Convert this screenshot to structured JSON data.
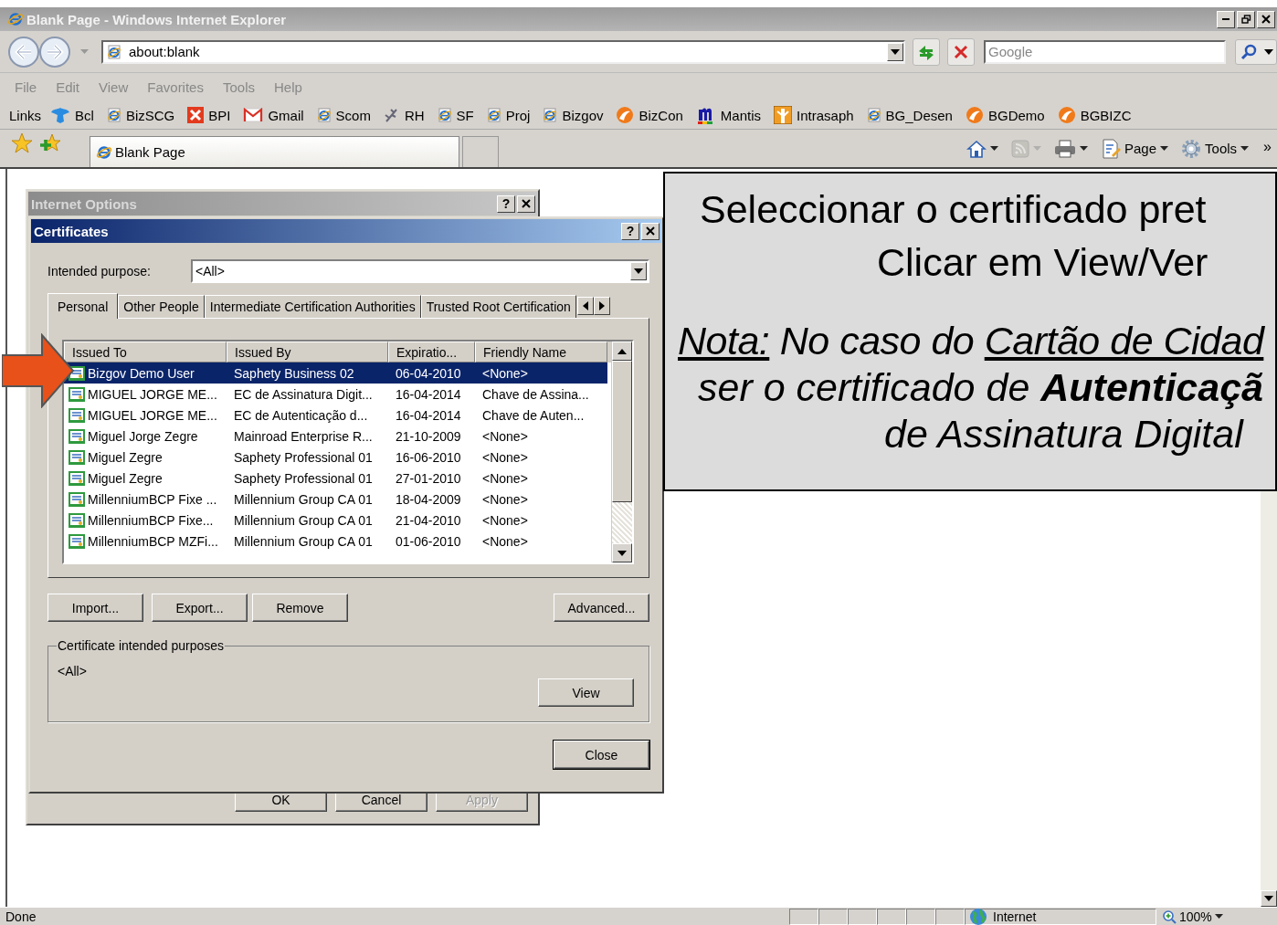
{
  "window": {
    "title": "Blank Page - Windows Internet Explorer"
  },
  "address_bar": {
    "value": "about:blank"
  },
  "search": {
    "placeholder": "Google"
  },
  "menu": [
    "File",
    "Edit",
    "View",
    "Favorites",
    "Tools",
    "Help"
  ],
  "links": {
    "label": "Links",
    "items": [
      {
        "label": "Bcl",
        "kind": "bird"
      },
      {
        "label": "BizSCG",
        "kind": "ie"
      },
      {
        "label": "BPI",
        "kind": "tile"
      },
      {
        "label": "Gmail",
        "kind": "mail"
      },
      {
        "label": "Scom",
        "kind": "ie"
      },
      {
        "label": "RH",
        "kind": "sprig"
      },
      {
        "label": "SF",
        "kind": "ie"
      },
      {
        "label": "Proj",
        "kind": "ie"
      },
      {
        "label": "Bizgov",
        "kind": "ie"
      },
      {
        "label": "BizCon",
        "kind": "orb"
      },
      {
        "label": "Mantis",
        "kind": "arch"
      },
      {
        "label": "Intrasaph",
        "kind": "tree"
      },
      {
        "label": "BG_Desen",
        "kind": "ie"
      },
      {
        "label": "BGDemo",
        "kind": "orb"
      },
      {
        "label": "BGBIZC",
        "kind": "orb"
      }
    ]
  },
  "tabs": [
    {
      "label": "Blank Page",
      "selected": true
    }
  ],
  "commands": [
    {
      "kind": "home",
      "disabled": false
    },
    {
      "kind": "feed",
      "disabled": true
    },
    {
      "kind": "print",
      "disabled": false
    },
    {
      "kind": "page",
      "label": "Page",
      "disabled": false
    },
    {
      "kind": "gear",
      "label": "Tools",
      "disabled": false
    }
  ],
  "overflow_chevron": "»",
  "internet_options": {
    "title": "Internet Options",
    "active": false,
    "help_button": "?",
    "buttons": [
      {
        "label": "OK",
        "disabled": false
      },
      {
        "label": "Cancel",
        "disabled": false
      },
      {
        "label": "Apply",
        "disabled": true
      }
    ]
  },
  "certificates": {
    "title": "Certificates",
    "active": true,
    "help_button": "?",
    "purpose_label": "Intended purpose:",
    "purpose_value": "<All>",
    "tabs": [
      {
        "label": "Personal",
        "selected": true
      },
      {
        "label": "Other People",
        "selected": false
      },
      {
        "label": "Intermediate Certification Authorities",
        "selected": false
      },
      {
        "label": "Trusted Root Certification",
        "selected": false
      }
    ],
    "columns": [
      "Issued To",
      "Issued By",
      "Expiratio...",
      "Friendly Name"
    ],
    "rows": [
      {
        "cells": [
          "Bizgov Demo User",
          "Saphety Business 02",
          "06-04-2010",
          "<None>"
        ],
        "selected": true
      },
      {
        "cells": [
          "MIGUEL JORGE ME...",
          "EC de Assinatura Digit...",
          "16-04-2014",
          "Chave de Assina..."
        ],
        "selected": false
      },
      {
        "cells": [
          "MIGUEL JORGE ME...",
          "EC de Autenticação d...",
          "16-04-2014",
          "Chave de Auten..."
        ],
        "selected": false
      },
      {
        "cells": [
          "Miguel Jorge Zegre",
          "Mainroad Enterprise R...",
          "21-10-2009",
          "<None>"
        ],
        "selected": false
      },
      {
        "cells": [
          "Miguel Zegre",
          "Saphety Professional 01",
          "16-06-2010",
          "<None>"
        ],
        "selected": false
      },
      {
        "cells": [
          "Miguel Zegre",
          "Saphety Professional 01",
          "27-01-2010",
          "<None>"
        ],
        "selected": false
      },
      {
        "cells": [
          "MillenniumBCP Fixe ...",
          "Millennium Group CA 01",
          "18-04-2009",
          "<None>"
        ],
        "selected": false
      },
      {
        "cells": [
          "MillenniumBCP Fixe...",
          "Millennium Group CA 01",
          "21-04-2010",
          "<None>"
        ],
        "selected": false
      },
      {
        "cells": [
          "MillenniumBCP MZFi...",
          "Millennium Group CA 01",
          "01-06-2010",
          "<None>"
        ],
        "selected": false
      }
    ],
    "buttons": [
      "Import...",
      "Export...",
      "Remove",
      "Advanced..."
    ],
    "group_label": "Certificate intended purposes",
    "group_value": "<All>",
    "view_button": "View",
    "close_button": "Close"
  },
  "callout": {
    "heading_lines": [
      "Seleccionar o certificado pret",
      "Clicar em View/Ver"
    ],
    "note_lines": [
      {
        "segments": [
          {
            "text": "Nota:",
            "underlined": true
          },
          {
            "text": " No caso do ",
            "underlined": false
          },
          {
            "text": "Cartão de Cidad",
            "underlined": true
          }
        ]
      },
      {
        "segments": [
          {
            "text": "ser o certificado de **Autenticaçã**",
            "underlined": false
          }
        ]
      },
      {
        "segments": [
          {
            "text": "de Assinatura Digital",
            "underlined": false
          }
        ]
      }
    ]
  },
  "status_bar": {
    "text": "Done",
    "zone": "Internet",
    "zoom": "100%"
  }
}
